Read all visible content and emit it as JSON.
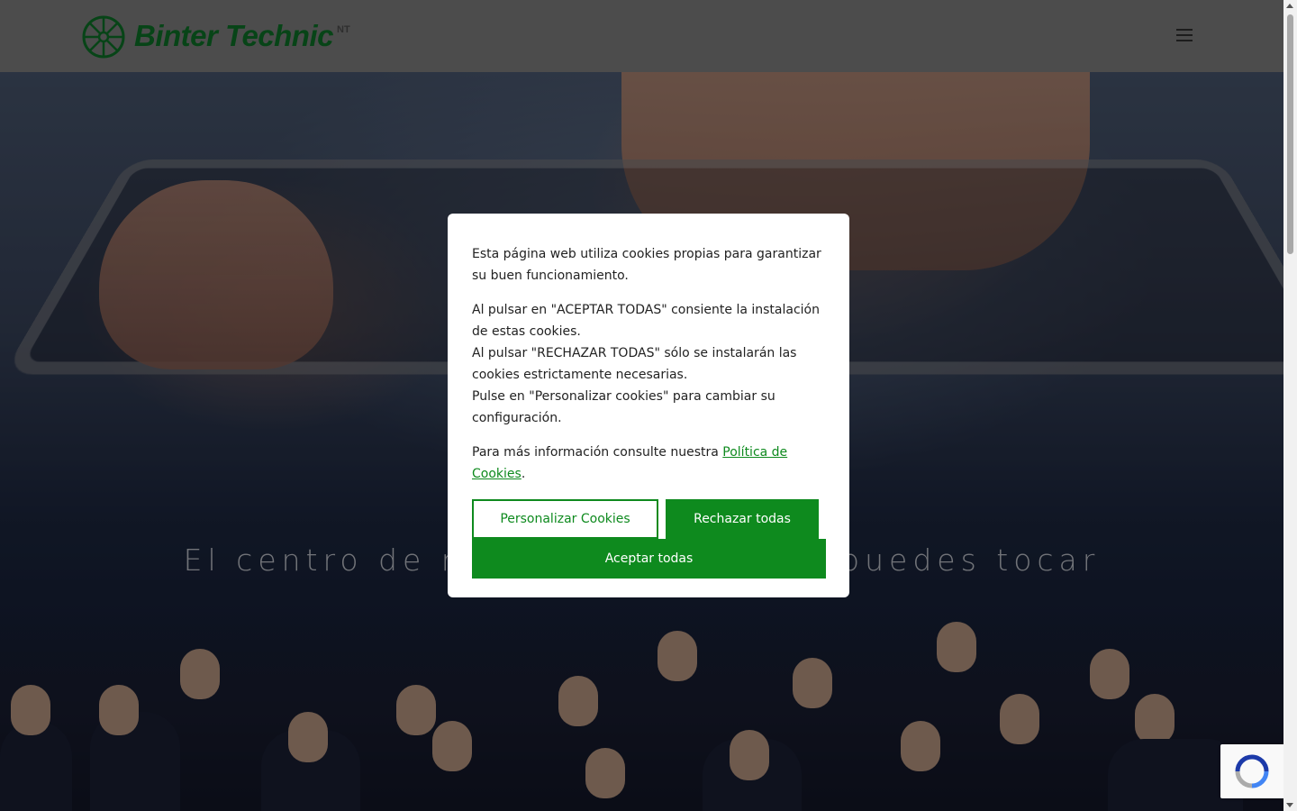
{
  "header": {
    "logo_text": "Binter Technic",
    "logo_sup": "NT",
    "menu_icon": "hamburger-menu-icon"
  },
  "hero": {
    "title": "El centro de mantenimiento que puedes tocar"
  },
  "cookie_modal": {
    "paragraph_1": "Esta página web utiliza cookies propias para garantizar su buen funcionamiento.",
    "paragraph_2_line_1": "Al pulsar en \"ACEPTAR TODAS\" consiente la instalación de estas cookies.",
    "paragraph_2_line_2": "Al pulsar \"RECHAZAR TODAS\" sólo se instalarán las cookies estrictamente necesarias.",
    "paragraph_2_line_3": "Pulse en \"Personalizar cookies\" para cambiar su configuración.",
    "info_prefix": "Para más información consulte nuestra ",
    "policy_link": "Política de Cookies",
    "info_suffix": ".",
    "customize_button": "Personalizar Cookies",
    "reject_button": "Rechazar todas",
    "accept_button": "Aceptar todas"
  },
  "colors": {
    "brand_green": "#0e8a1e",
    "logo_green": "#0e7d2a",
    "header_bg": "#8a8a8a"
  },
  "recaptcha": {
    "icon": "recaptcha-icon"
  }
}
